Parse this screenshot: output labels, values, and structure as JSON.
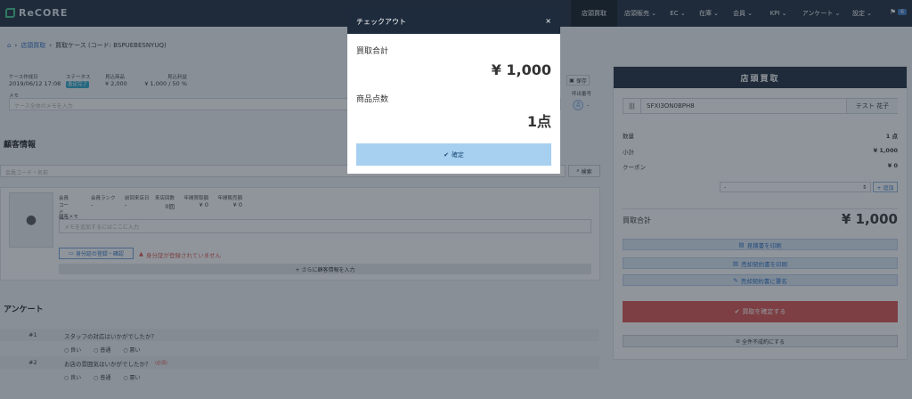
{
  "app": {
    "logo_text": "ReCORE"
  },
  "nav": [
    {
      "label": "店頭買取"
    },
    {
      "label": "店頭販売 ⌄"
    },
    {
      "label": "EC ⌄"
    },
    {
      "label": "在庫 ⌄"
    },
    {
      "label": "会員 ⌄"
    },
    {
      "label": "KPI ⌄"
    },
    {
      "label": "アンケート ⌄"
    },
    {
      "label": "設定 ⌄"
    }
  ],
  "notification_count": "6",
  "breadcrumb": {
    "home": "店頭買取",
    "current": "買取ケース (コード: BSPUEBESNYUQ)"
  },
  "case": {
    "created_label": "ケース作成日",
    "created_value": "2019/06/12 17:08",
    "status_label": "ステータス",
    "status_value": "査定完了",
    "total_label": "見込商品",
    "total_value": "¥ 2,000",
    "profit_label": "見込利益",
    "profit_value": "¥ 1,000 / 50 %",
    "memo_label": "メモ",
    "memo_placeholder": "ケース全体のメモを入力",
    "save_label": "保存",
    "ticket_label": "呼出番号",
    "ticket_value": "-"
  },
  "customer": {
    "heading": "顧客情報",
    "search_placeholder": "会員コード・名前",
    "search_button": "検索",
    "cols": [
      {
        "label": "会員コード",
        "value": "非会員"
      },
      {
        "label": "会員ランク",
        "value": "-"
      },
      {
        "label": "前回来店日",
        "value": "-"
      },
      {
        "label": "来店回数",
        "value": "0回"
      },
      {
        "label": "年間買取額",
        "value": "¥ 0"
      },
      {
        "label": "年間販売額",
        "value": "¥ 0"
      }
    ],
    "memo_label": "顧客メモ",
    "memo_placeholder": "メモを追加するにはここに入力",
    "id_button": "身分証の登録・確認",
    "id_warning": "身分証が登録されていません",
    "more_button": "+ さらに顧客情報を入力"
  },
  "survey": {
    "heading": "アンケート",
    "questions": [
      {
        "num": "#1",
        "text": "スタッフの対応はいかがでしたか？",
        "required": ""
      },
      {
        "num": "#2",
        "text": "お店の雰囲気はいかがでしたか？",
        "required": "(必須)"
      }
    ],
    "options": [
      "良い",
      "普通",
      "悪い"
    ]
  },
  "right_panel": {
    "title": "店頭買取",
    "code_value": "SFXI3ON0BPH8",
    "staff": "テスト 花子",
    "qty_label": "数量",
    "qty_value": "1 点",
    "subtotal_label": "小計",
    "subtotal_value": "¥ 1,000",
    "coupon_label": "クーポン",
    "coupon_value": "¥ 0",
    "select_value": "-",
    "add_label": "+ 追加",
    "total_label": "買取合計",
    "total_value": "¥ 1,000",
    "btn_estimate": "見積書を印刷",
    "btn_contract": "売却契約書を印刷",
    "btn_sign": "売却契約書に署名",
    "btn_confirm": "買取を確定する",
    "btn_reject": "全件不成約にする"
  },
  "modal": {
    "title": "チェックアウト",
    "close": "×",
    "total_label": "買取合計",
    "total_value": "¥ 1,000",
    "count_label": "商品点数",
    "count_value": "1点",
    "confirm_label": "確定"
  },
  "colors": {
    "topbar": "#1d2b3c",
    "accent": "#2a6fc0",
    "danger": "#d9534f",
    "confirm_btn": "#a7cff0"
  }
}
